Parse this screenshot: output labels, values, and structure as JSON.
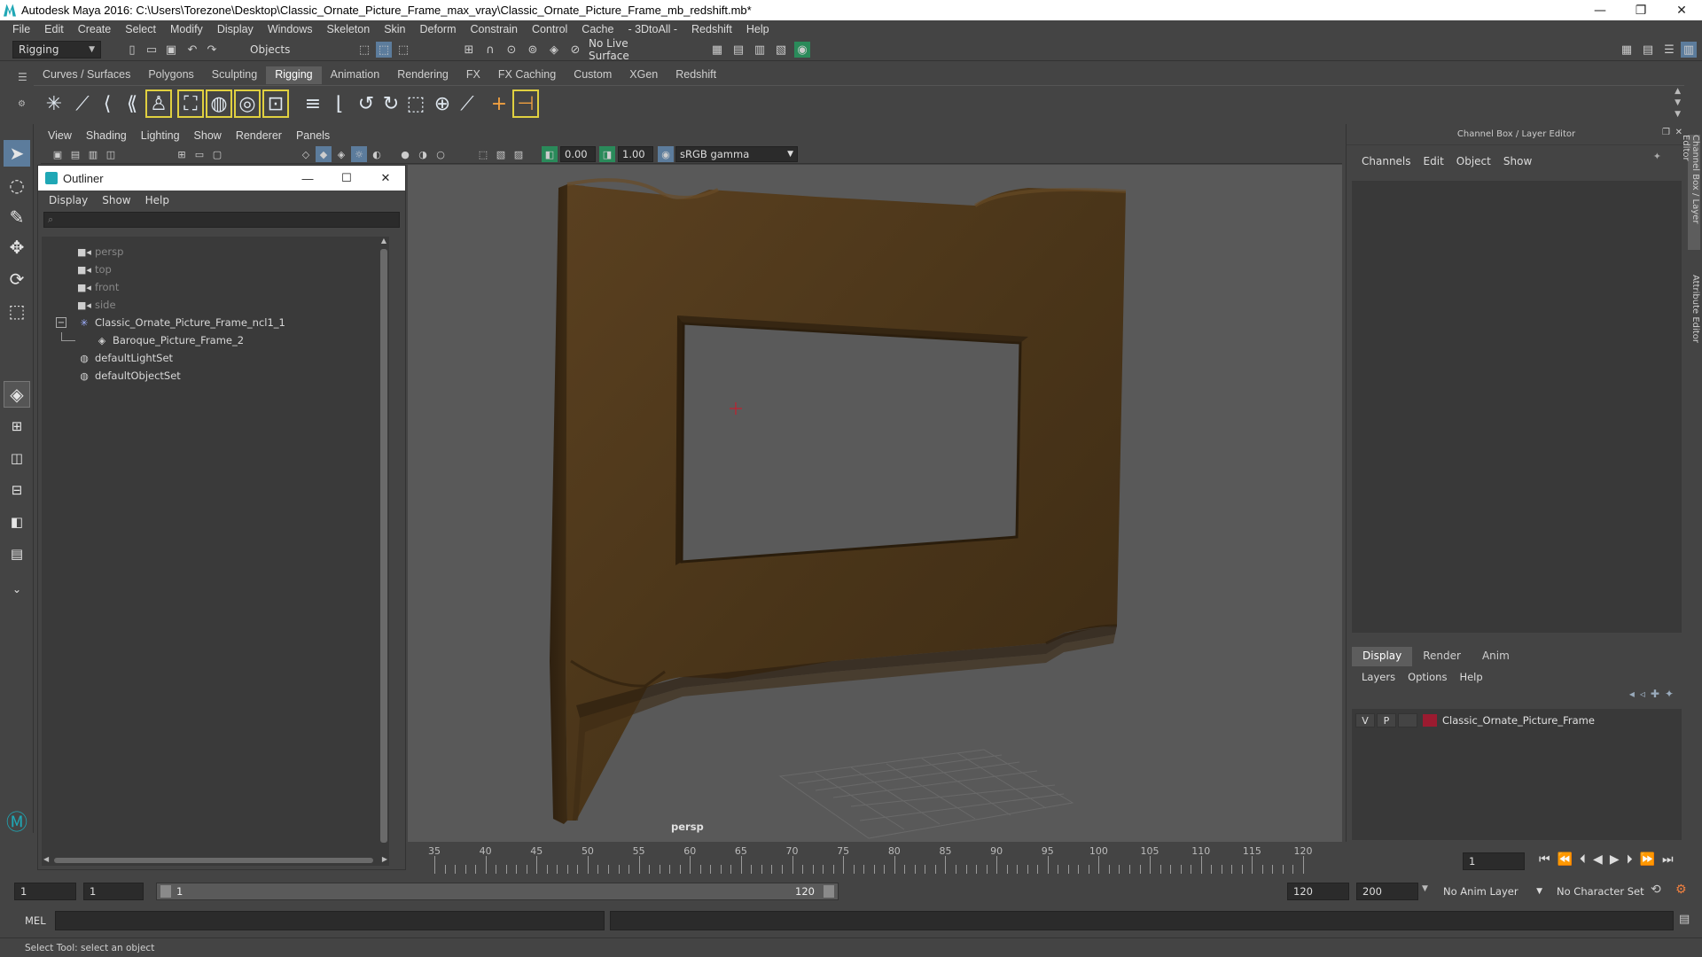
{
  "window": {
    "title": "Autodesk Maya 2016: C:\\Users\\Torezone\\Desktop\\Classic_Ornate_Picture_Frame_max_vray\\Classic_Ornate_Picture_Frame_mb_redshift.mb*",
    "minimize": "—",
    "restore": "❐",
    "close": "✕"
  },
  "menubar": [
    "File",
    "Edit",
    "Create",
    "Select",
    "Modify",
    "Display",
    "Windows",
    "Skeleton",
    "Skin",
    "Deform",
    "Constrain",
    "Control",
    "Cache",
    "- 3DtoAll -",
    "Redshift",
    "Help"
  ],
  "statusline": {
    "menuset": "Rigging",
    "selection_mode": "Objects",
    "live_surface": "No Live Surface"
  },
  "shelf_tabs": [
    "Curves / Surfaces",
    "Polygons",
    "Sculpting",
    "Rigging",
    "Animation",
    "Rendering",
    "FX",
    "FX Caching",
    "Custom",
    "XGen",
    "Redshift"
  ],
  "shelf_active": "Rigging",
  "panel_menus": [
    "View",
    "Shading",
    "Lighting",
    "Show",
    "Renderer",
    "Panels"
  ],
  "panel_toolbar": {
    "exposure": "0.00",
    "gamma": "1.00",
    "color_space": "sRGB gamma"
  },
  "viewport": {
    "camera_label": "persp"
  },
  "outliner": {
    "title": "Outliner",
    "menus": [
      "Display",
      "Show",
      "Help"
    ],
    "items": [
      {
        "label": "persp",
        "icon": "camera-icon",
        "dim": true,
        "indent": 0
      },
      {
        "label": "top",
        "icon": "camera-icon",
        "dim": true,
        "indent": 0
      },
      {
        "label": "front",
        "icon": "camera-icon",
        "dim": true,
        "indent": 0
      },
      {
        "label": "side",
        "icon": "camera-icon",
        "dim": true,
        "indent": 0
      },
      {
        "label": "Classic_Ornate_Picture_Frame_ncl1_1",
        "icon": "transform-icon",
        "dim": false,
        "indent": 0,
        "expanded": true
      },
      {
        "label": "Baroque_Picture_Frame_2",
        "icon": "mesh-icon",
        "dim": false,
        "indent": 1
      },
      {
        "label": "defaultLightSet",
        "icon": "set-icon",
        "dim": false,
        "indent": 0
      },
      {
        "label": "defaultObjectSet",
        "icon": "set-icon",
        "dim": false,
        "indent": 0
      }
    ]
  },
  "channel_box": {
    "header": "Channel Box / Layer Editor",
    "menus": [
      "Channels",
      "Edit",
      "Object",
      "Show"
    ],
    "layer_tabs": [
      "Display",
      "Render",
      "Anim"
    ],
    "layer_tab_active": "Display",
    "layer_menus": [
      "Layers",
      "Options",
      "Help"
    ],
    "layer": {
      "visible": "V",
      "playback": "P",
      "name": "Classic_Ornate_Picture_Frame",
      "color": "#9b1b30"
    },
    "vertical_tabs": [
      "Channel Box / Layer Editor",
      "Attribute Editor"
    ]
  },
  "timeslider": {
    "ticks": [
      "35",
      "40",
      "45",
      "50",
      "55",
      "60",
      "65",
      "70",
      "75",
      "80",
      "85",
      "90",
      "95",
      "100",
      "105",
      "110",
      "115",
      "120"
    ],
    "current_frame": "1"
  },
  "range": {
    "start": "1",
    "playback_start": "1",
    "slider_start": "1",
    "slider_end": "120",
    "playback_end": "120",
    "end": "200",
    "anim_layer": "No Anim Layer",
    "character_set": "No Character Set"
  },
  "command": {
    "language": "MEL"
  },
  "helpline": "Select Tool: select an object",
  "colors": {
    "accent": "#5c7c9c",
    "frame_wood": "#4a3519",
    "viewport_bg": "#595959"
  }
}
